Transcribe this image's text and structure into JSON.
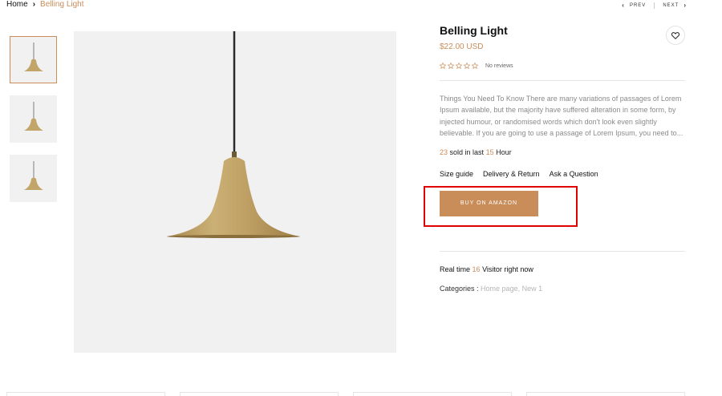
{
  "breadcrumb": {
    "home": "Home",
    "current": "Belling Light"
  },
  "pager": {
    "prev": "PREV",
    "next": "NEXT"
  },
  "product": {
    "title": "Belling Light",
    "price": "$22.00 USD",
    "rating": {
      "stars": 0,
      "max": 5,
      "reviews": "No reviews"
    },
    "description": "Things You Need To Know There are many variations of passages of Lorem Ipsum available, but the majority have suffered alteration in some form, by injected humour, or randomised words which don't look even slightly believable. If you are going to use a passage of Lorem Ipsum, you need to...",
    "sold": {
      "count": "23",
      "text_mid": "sold in last",
      "hours": "15",
      "text_end": "Hour"
    },
    "links": [
      "Size guide",
      "Delivery & Return",
      "Ask a Question"
    ],
    "buy_label": "BUY ON AMAZON",
    "visitors": {
      "prefix": "Real time",
      "count": "16",
      "suffix": "Visitor right now"
    },
    "categories": {
      "label": "Categories :",
      "values": "Home page, New 1"
    }
  },
  "colors": {
    "accent": "#c98d5a",
    "highlight": "#e10000",
    "image_bg": "#f1f1f1"
  },
  "icons": {
    "wishlist": "heart-icon",
    "prev": "chevron-left-icon",
    "next": "chevron-right-icon",
    "breadcrumb_sep": "chevron-right-icon"
  }
}
